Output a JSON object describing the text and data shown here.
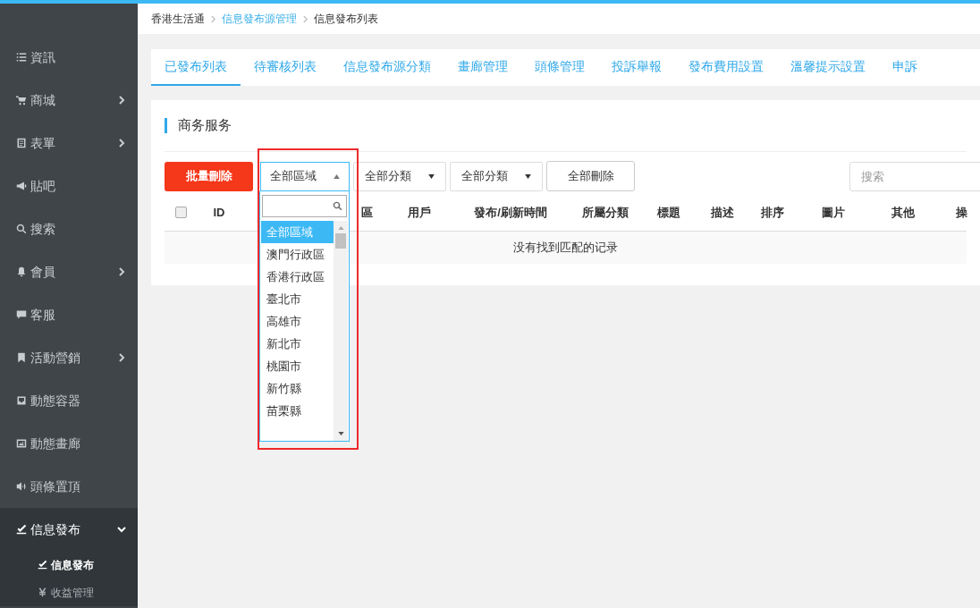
{
  "sidebar": {
    "items": [
      {
        "label": "資訊",
        "kind": "list",
        "has_arrow": false,
        "expanded": false
      },
      {
        "label": "商城",
        "kind": "cart",
        "has_arrow": true,
        "expanded": false
      },
      {
        "label": "表單",
        "kind": "form",
        "has_arrow": true,
        "expanded": false
      },
      {
        "label": "貼吧",
        "kind": "bullhorn",
        "has_arrow": false,
        "expanded": false
      },
      {
        "label": "搜索",
        "kind": "search",
        "has_arrow": false,
        "expanded": false
      },
      {
        "label": "會員",
        "kind": "bell",
        "has_arrow": true,
        "expanded": false
      },
      {
        "label": "客服",
        "kind": "chat",
        "has_arrow": false,
        "expanded": false
      },
      {
        "label": "活動營銷",
        "kind": "bookmark",
        "has_arrow": true,
        "expanded": false
      },
      {
        "label": "動態容器",
        "kind": "box",
        "has_arrow": false,
        "expanded": false
      },
      {
        "label": "動態畫廊",
        "kind": "image",
        "has_arrow": false,
        "expanded": false
      },
      {
        "label": "頭條置頂",
        "kind": "volume",
        "has_arrow": false,
        "expanded": false
      },
      {
        "label": "信息發布",
        "kind": "edit",
        "has_arrow": true,
        "expanded": true,
        "children": [
          {
            "label": "信息發布",
            "kind": "edit",
            "selected": true
          },
          {
            "label": "收益管理",
            "kind": "yen",
            "selected": false
          }
        ]
      }
    ]
  },
  "breadcrumb": [
    {
      "label": "香港生活通",
      "link": false
    },
    {
      "label": "信息發布源管理",
      "link": true
    },
    {
      "label": "信息發布列表",
      "link": false
    }
  ],
  "tabs": [
    {
      "label": "已發布列表",
      "selected": true
    },
    {
      "label": "待審核列表",
      "selected": false
    },
    {
      "label": "信息發布源分類",
      "selected": false
    },
    {
      "label": "畫廊管理",
      "selected": false
    },
    {
      "label": "頭條管理",
      "selected": false
    },
    {
      "label": "投訴舉報",
      "selected": false
    },
    {
      "label": "發布費用設置",
      "selected": false
    },
    {
      "label": "溫馨提示設置",
      "selected": false
    },
    {
      "label": "申訴",
      "selected": false
    }
  ],
  "panel_title": "商务服务",
  "toolbar": {
    "delete_button": "批量刪除",
    "region_select": "全部區域",
    "category_selects": [
      "全部分類",
      "全部分類"
    ],
    "delete_all_button": "全部刪除",
    "search": {
      "placeholder": "搜索"
    }
  },
  "table": {
    "select_all_checked": false,
    "columns": [
      "ID",
      "區",
      "用戶",
      "發布/刷新時間",
      "所屬分類",
      "標題",
      "描述",
      "排序",
      "圖片",
      "其他",
      "操"
    ],
    "empty_message": "没有找到匹配的记录"
  },
  "region_dropdown": {
    "options": [
      {
        "label": "全部區域",
        "selected": true
      },
      {
        "label": "澳門行政區",
        "selected": false
      },
      {
        "label": "香港行政區",
        "selected": false
      },
      {
        "label": "臺北市",
        "selected": false
      },
      {
        "label": "高雄市",
        "selected": false
      },
      {
        "label": "新北市",
        "selected": false
      },
      {
        "label": "桃園市",
        "selected": false
      },
      {
        "label": "新竹縣",
        "selected": false
      },
      {
        "label": "苗栗縣",
        "selected": false
      }
    ]
  }
}
